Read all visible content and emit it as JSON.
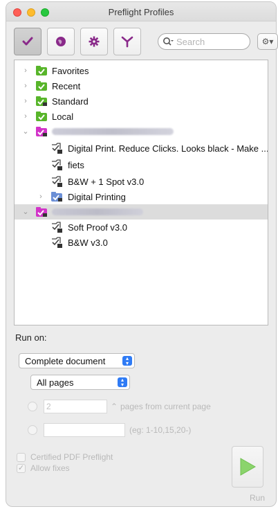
{
  "window": {
    "title": "Preflight Profiles"
  },
  "toolbar": {
    "buttons": [
      {
        "name": "profiles-button",
        "icon": "checkmark-icon",
        "active": true
      },
      {
        "name": "checks-button",
        "icon": "globe-icon",
        "active": false
      },
      {
        "name": "fixups-button",
        "icon": "gear-icon",
        "active": false
      },
      {
        "name": "actions-button",
        "icon": "branch-icon",
        "active": false
      }
    ],
    "search_placeholder": "Search",
    "gear_menu_icon": "gear-dropdown-icon"
  },
  "tree": {
    "items": [
      {
        "label": "Favorites",
        "type": "group",
        "expanded": false,
        "icon": "green-check-folder-icon"
      },
      {
        "label": "Recent",
        "type": "group",
        "expanded": false,
        "icon": "green-check-folder-icon"
      },
      {
        "label": "Standard",
        "type": "group",
        "expanded": false,
        "icon": "green-check-locked-folder-icon"
      },
      {
        "label": "Local",
        "type": "group",
        "expanded": false,
        "icon": "green-check-folder-icon"
      },
      {
        "label": "",
        "type": "account",
        "expanded": true,
        "icon": "magenta-check-folder-icon",
        "blurred": true
      },
      {
        "label": "Digital Print. Reduce Clicks. Looks black - Make ...",
        "type": "profile",
        "icon": "locked-profile-icon"
      },
      {
        "label": "fiets",
        "type": "profile",
        "icon": "locked-profile-icon"
      },
      {
        "label": "B&W + 1 Spot v3.0",
        "type": "profile",
        "icon": "locked-profile-icon"
      },
      {
        "label": "Digital Printing",
        "type": "subgroup",
        "expanded": false,
        "icon": "blue-check-locked-folder-icon"
      },
      {
        "label": "",
        "type": "account",
        "expanded": true,
        "selected": true,
        "icon": "magenta-check-folder-icon",
        "blurred": true
      },
      {
        "label": "Soft Proof v3.0",
        "type": "profile",
        "icon": "locked-profile-icon"
      },
      {
        "label": "B&W v3.0",
        "type": "profile",
        "icon": "locked-profile-icon"
      }
    ]
  },
  "run_on": {
    "label": "Run on:",
    "scope_value": "Complete document",
    "pages_value": "All pages",
    "pages_from_value": "2",
    "pages_from_label": "pages from current page",
    "range_hint": "(eg: 1-10,15,20-)",
    "certified_label": "Certified PDF Preflight",
    "allow_fixes_label": "Allow fixes",
    "run_label": "Run"
  },
  "colors": {
    "accent": "#2f7bf5",
    "green_folder": "#58b52a",
    "magenta_folder": "#d233c8",
    "run_arrow": "#8bd46c"
  }
}
